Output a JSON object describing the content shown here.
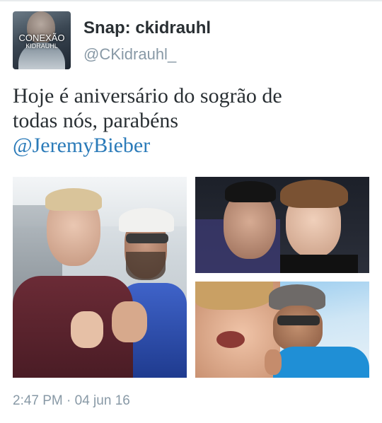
{
  "tweet": {
    "display_name": "Snap: ckidrauhl",
    "handle": "@CKidrauhl_",
    "text_line1": "Hoje é aniversário do sogrão de",
    "text_line2": "todas nós, parabéns",
    "mention": "@JeremyBieber",
    "timestamp": "2:47 PM · 04 jun 16"
  },
  "avatar": {
    "line1": "CONEXÃO",
    "line2": "KIDRAUHL"
  },
  "colors": {
    "name": "#292f33",
    "secondary": "#8899a6",
    "link": "#2b7bb9"
  }
}
